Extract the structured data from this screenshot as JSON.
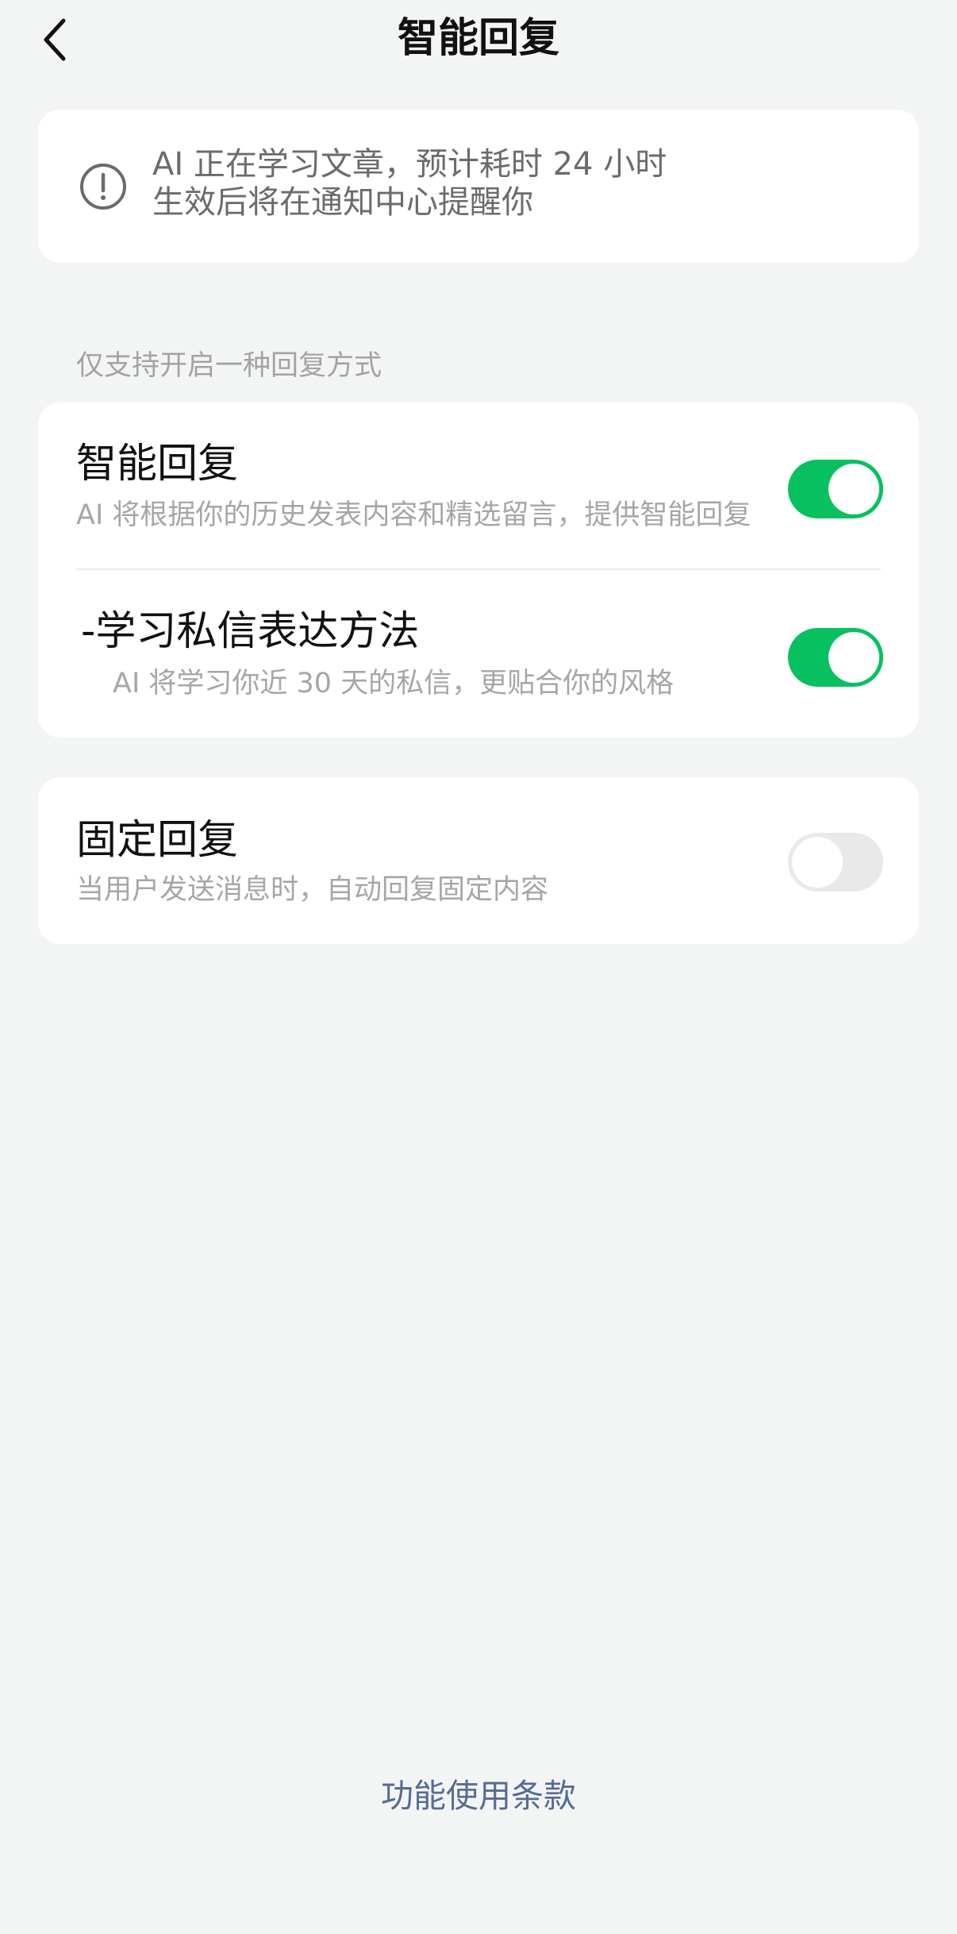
{
  "header": {
    "title": "智能回复",
    "back_icon": "chevron-left-icon"
  },
  "notice": {
    "icon": "exclamation-circle-icon",
    "line1": "AI 正在学习文章，预计耗时 24 小时",
    "line2": "生效后将在通知中心提醒你"
  },
  "section_hint": "仅支持开启一种回复方式",
  "smart_reply": {
    "title": "智能回复",
    "description": "AI 将根据你的历史发表内容和精选留言，提供智能回复",
    "enabled": true,
    "sub_option": {
      "title": "-学习私信表达方法",
      "description": "AI 将学习你近 30 天的私信，更贴合你的风格",
      "enabled": true
    }
  },
  "fixed_reply": {
    "title": "固定回复",
    "description": "当用户发送消息时，自动回复固定内容",
    "enabled": false
  },
  "footer": {
    "terms_link": "功能使用条款"
  },
  "colors": {
    "background": "#f3f5f5",
    "toggle_on": "#07c160",
    "toggle_off": "#e9e9e9",
    "link": "#576b95"
  }
}
